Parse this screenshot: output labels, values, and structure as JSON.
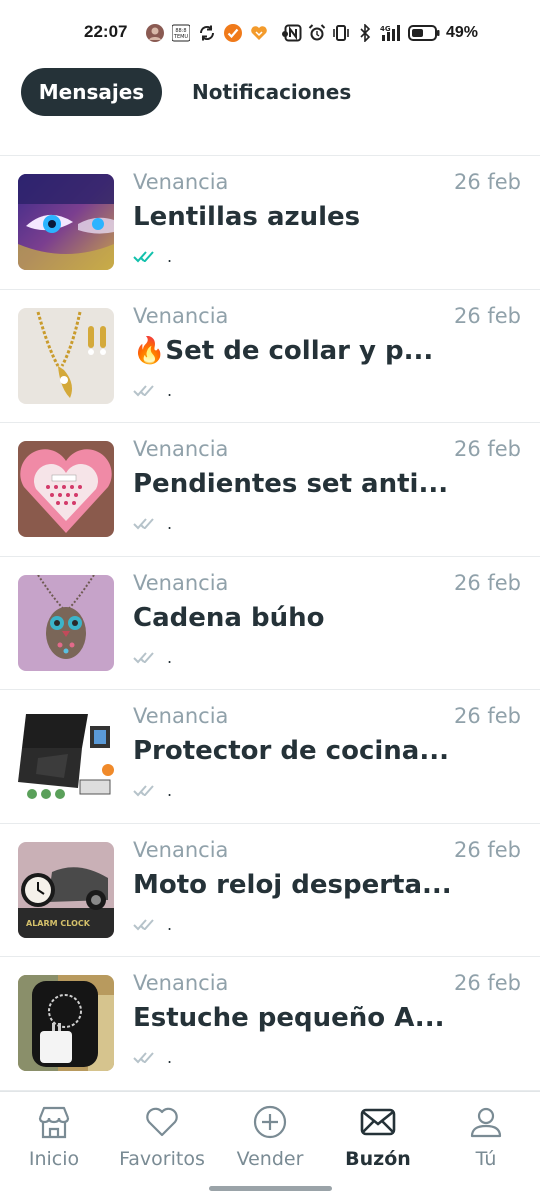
{
  "status_bar": {
    "time": "22:07",
    "battery": "49%",
    "left_icons": [
      "avatar-icon",
      "temu-app-icon",
      "sync-icon",
      "check-app-icon",
      "heart-app-icon",
      "dot-icon"
    ],
    "right_icons": [
      "nfc-icon",
      "alarm-icon",
      "vibrate-icon",
      "bluetooth-icon",
      "signal-4g-icon",
      "battery-icon"
    ]
  },
  "tabs": {
    "active": "Mensajes",
    "inactive": "Notificaciones"
  },
  "messages": [
    {
      "sender": "Venancia",
      "date": "26 feb",
      "title": "Lentillas azules",
      "preview": ".",
      "read_status": "read",
      "thumb": "blue-eye-makeup"
    },
    {
      "sender": "Venancia",
      "date": "26 feb",
      "title": "🔥Set de collar y p...",
      "preview": ".",
      "read_status": "sent",
      "thumb": "gold-necklace-set"
    },
    {
      "sender": "Venancia",
      "date": "26 feb",
      "title": "Pendientes set anti...",
      "preview": ".",
      "read_status": "sent",
      "thumb": "pink-heart-earring-box"
    },
    {
      "sender": "Venancia",
      "date": "26 feb",
      "title": "Cadena búho",
      "preview": ".",
      "read_status": "sent",
      "thumb": "owl-pendant"
    },
    {
      "sender": "Venancia",
      "date": "26 feb",
      "title": "Protector de cocina...",
      "preview": ".",
      "read_status": "sent",
      "thumb": "stove-protector"
    },
    {
      "sender": "Venancia",
      "date": "26 feb",
      "title": "Moto reloj desperta...",
      "preview": ".",
      "read_status": "sent",
      "thumb": "motorcycle-alarm-clock"
    },
    {
      "sender": "Venancia",
      "date": "26 feb",
      "title": "Estuche pequeño A...",
      "preview": ".",
      "read_status": "sent",
      "thumb": "small-case-with-charger"
    }
  ],
  "bottom_nav": {
    "items": [
      {
        "label": "Inicio",
        "icon": "home-icon"
      },
      {
        "label": "Favoritos",
        "icon": "heart-icon"
      },
      {
        "label": "Vender",
        "icon": "plus-circle-icon"
      },
      {
        "label": "Buzón",
        "icon": "mail-icon",
        "active": true
      },
      {
        "label": "Tú",
        "icon": "user-icon"
      }
    ]
  },
  "colors": {
    "primary_dark": "#253238",
    "muted_text": "#90a1aa",
    "read_check": "#13c1ac",
    "sent_check": "#b6c3ca"
  }
}
